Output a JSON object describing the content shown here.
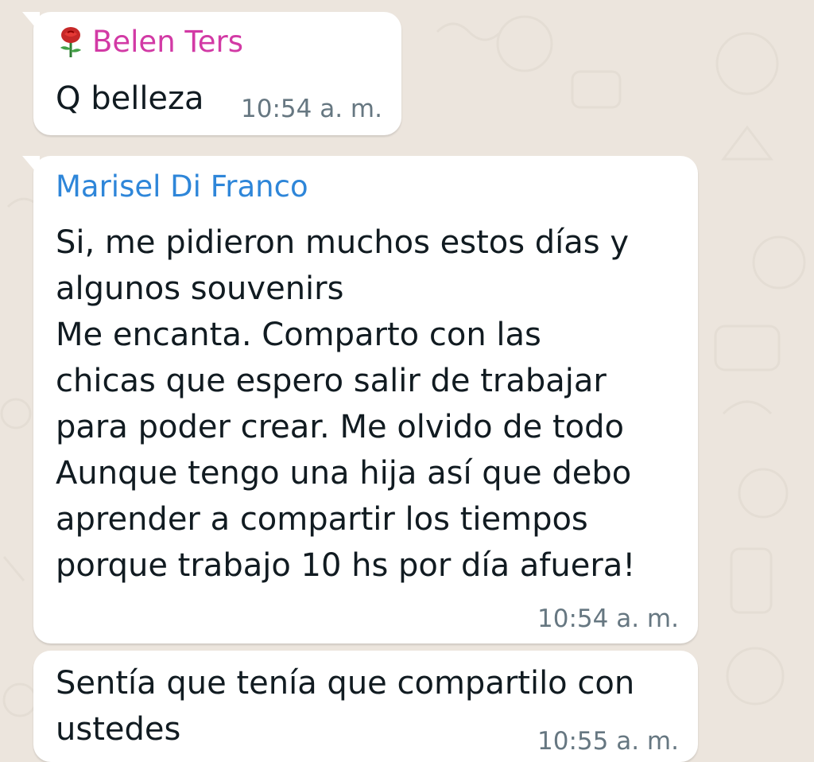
{
  "colors": {
    "background": "#ece5dd",
    "bubble": "#ffffff",
    "belen_name": "#d23aa5",
    "marisel_name": "#2e86d9",
    "message_text": "#111b21",
    "timestamp": "#667781"
  },
  "messages": [
    {
      "sender": "Belen Ters",
      "sender_icon": "rose-icon",
      "text": "Q belleza",
      "time": "10:54 a. m."
    },
    {
      "sender": "Marisel Di Franco",
      "text": "Si, me pidieron muchos estos días y\nalgunos souvenirs\nMe encanta. Comparto con las\nchicas que espero salir de trabajar\npara poder crear. Me olvido de todo\nAunque tengo una hija así que debo\naprender a compartir los tiempos\nporque trabajo 10 hs por día afuera!",
      "time": "10:54 a. m."
    },
    {
      "text": "Sentía que tenía que compartilo con\nustedes",
      "time": "10:55 a. m."
    }
  ]
}
